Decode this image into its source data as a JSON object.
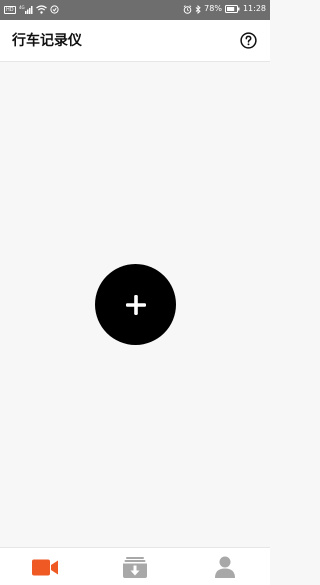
{
  "status_bar": {
    "hd_badge": "HD",
    "signal_text": "4G",
    "battery_text": "78%",
    "time": "11:28"
  },
  "header": {
    "title": "行车记录仪",
    "help_icon": "question-circle-icon"
  },
  "main": {
    "add_icon": "plus-icon"
  },
  "bottom_nav": {
    "items": [
      {
        "icon": "video-camera-icon",
        "active": true
      },
      {
        "icon": "download-tray-icon",
        "active": false
      },
      {
        "icon": "person-icon",
        "active": false
      }
    ]
  },
  "colors": {
    "accent": "#ef5a24",
    "inactive": "#a8a8a8",
    "status_bar": "#6e6e6e",
    "add_button": "#000000",
    "background": "#f7f7f7"
  }
}
